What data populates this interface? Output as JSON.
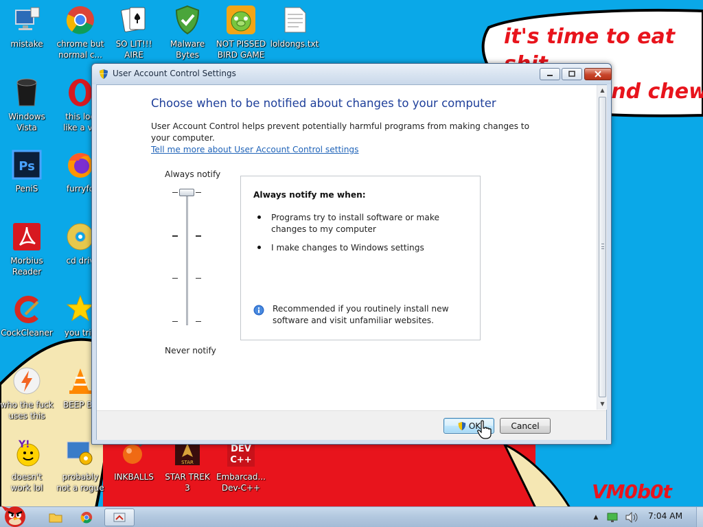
{
  "wallpaper": {
    "bubble_text": "it's time to eat shit\nand die and chew\nm",
    "signature": "VM0b0t",
    "colors": {
      "sky": "#0aa8e8",
      "red": "#e8141c",
      "skin": "#f5e7b3"
    }
  },
  "desktop_icons": [
    {
      "label": "mistake",
      "icon": "computer-icon"
    },
    {
      "label": "chrome but\nnormal c...",
      "icon": "chrome-icon"
    },
    {
      "label": "SO LIT!!!\nAIRE",
      "icon": "solitaire-icon"
    },
    {
      "label": "Malware\nBytes",
      "icon": "shield-check-icon"
    },
    {
      "label": "NOT PISSED\nBIRD GAME",
      "icon": "pig-icon"
    },
    {
      "label": "loldongs.txt",
      "icon": "text-file-icon"
    },
    {
      "label": "Windows\nVista",
      "icon": "bin-icon"
    },
    {
      "label": "this loo\nlike a va",
      "icon": "opera-icon"
    },
    {
      "label": "PeniS",
      "icon": "photoshop-icon"
    },
    {
      "label": "furryfo",
      "icon": "firefox-icon"
    },
    {
      "label": "Morbius\nReader",
      "icon": "pdf-reader-icon"
    },
    {
      "label": "cd driv",
      "icon": "cd-icon"
    },
    {
      "label": "CockCleaner",
      "icon": "ccleaner-icon"
    },
    {
      "label": "you trie",
      "icon": "star-icon"
    },
    {
      "label": "who the fuck\nuses this",
      "icon": "flash-icon"
    },
    {
      "label": "BEEP BE",
      "icon": "vlc-icon"
    },
    {
      "label": "doesn't\nwork lol",
      "icon": "yahoo-messenger-icon"
    },
    {
      "label": "probably\nnot a rogue",
      "icon": "gears-icon"
    },
    {
      "label": "INKBALLS",
      "icon": "inkball-icon"
    },
    {
      "label": "STAR TREK\n3",
      "icon": "star-trek-icon"
    },
    {
      "label": "Embarcad...\nDev-C++",
      "icon": "devcpp-icon"
    }
  ],
  "dialog": {
    "title": "User Account Control Settings",
    "heading": "Choose when to be notified about changes to your computer",
    "description": "User Account Control helps prevent potentially harmful programs from making changes to your computer.",
    "link": "Tell me more about User Account Control settings",
    "slider": {
      "top_label": "Always notify",
      "bottom_label": "Never notify",
      "levels": 4,
      "selected_level": 4
    },
    "info": {
      "title": "Always notify me when:",
      "bullets": [
        "Programs try to install software or make changes to my computer",
        "I make changes to Windows settings"
      ],
      "recommendation": "Recommended if you routinely install new software and visit unfamiliar websites."
    },
    "buttons": {
      "ok": "OK",
      "cancel": "Cancel"
    },
    "window_controls": {
      "minimize": "minimize-icon",
      "maximize": "maximize-icon",
      "close": "close-icon"
    }
  },
  "taskbar": {
    "pinned": [
      {
        "name": "angry-bird-start-icon"
      },
      {
        "name": "explorer-icon"
      },
      {
        "name": "chrome-icon"
      },
      {
        "name": "uac-settings-icon"
      }
    ],
    "tray_icons": [
      "show-hidden-icons-icon",
      "network-icon",
      "volume-icon"
    ],
    "clock": "7:04 AM"
  }
}
